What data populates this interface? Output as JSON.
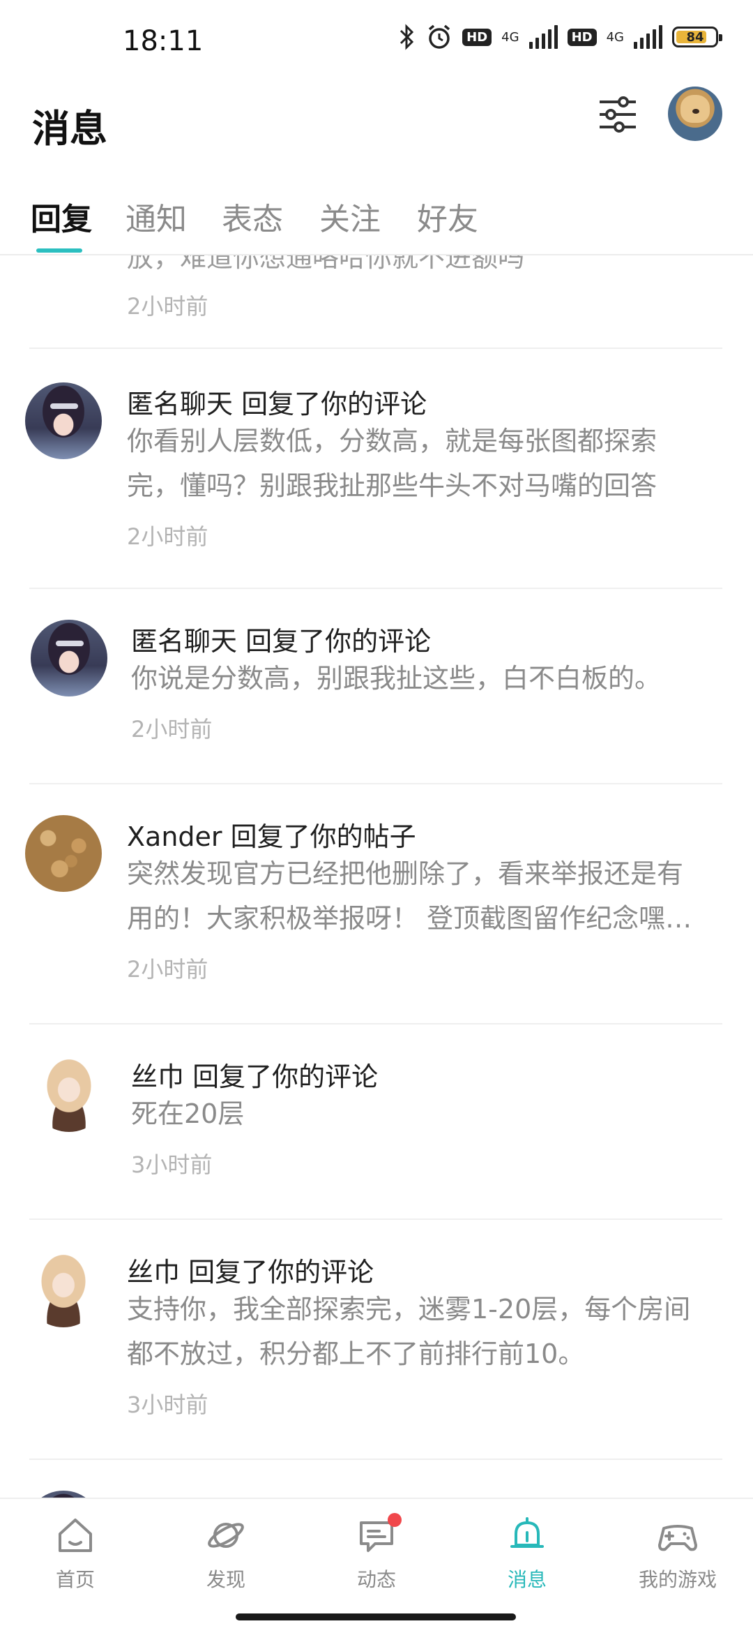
{
  "status_bar": {
    "time": "18:11",
    "net1": "4G",
    "net2": "4G",
    "hd": "HD",
    "battery": "84"
  },
  "header": {
    "title": "消息"
  },
  "tabs": [
    "回复",
    "通知",
    "表态",
    "关注",
    "好友"
  ],
  "partial_item": {
    "text": "放，难道你想通咯哈你就不进额吗",
    "time": "2小时前"
  },
  "items": [
    {
      "title": "匿名聊天 回复了你的评论",
      "body_lines": [
        "你看别人层数低，分数高，就是每张图都探索",
        "完，懂吗？别跟我扯那些牛头不对马嘴的回答"
      ],
      "time": "2小时前"
    },
    {
      "title": "匿名聊天 回复了你的评论",
      "body_lines": [
        "你说是分数高，别跟我扯这些，白不白板的。"
      ],
      "time": "2小时前"
    },
    {
      "title": "Xander 回复了你的帖子",
      "body_lines": [
        "突然发现官方已经把他删除了，看来举报还是有",
        "用的！大家积极举报呀！ 登顶截图留作纪念嘿…"
      ],
      "time": "2小时前"
    },
    {
      "title": "丝巾 回复了你的评论",
      "body_lines": [
        "死在20层"
      ],
      "time": "3小时前"
    },
    {
      "title": "丝巾 回复了你的评论",
      "body_lines": [
        "支持你，我全部探索完，迷雾1-20层，每个房间",
        "都不放过，积分都上不了前排行前10。"
      ],
      "time": "3小时前"
    }
  ],
  "bottom_nav": [
    {
      "label": "首页",
      "icon": "home-icon"
    },
    {
      "label": "发现",
      "icon": "discover-planet-icon"
    },
    {
      "label": "动态",
      "icon": "feed-chat-icon"
    },
    {
      "label": "消息",
      "icon": "bell-icon"
    },
    {
      "label": "我的游戏",
      "icon": "gamepad-icon"
    }
  ],
  "colors": {
    "accent": "#2bbfc0",
    "badge": "#f0474b"
  }
}
